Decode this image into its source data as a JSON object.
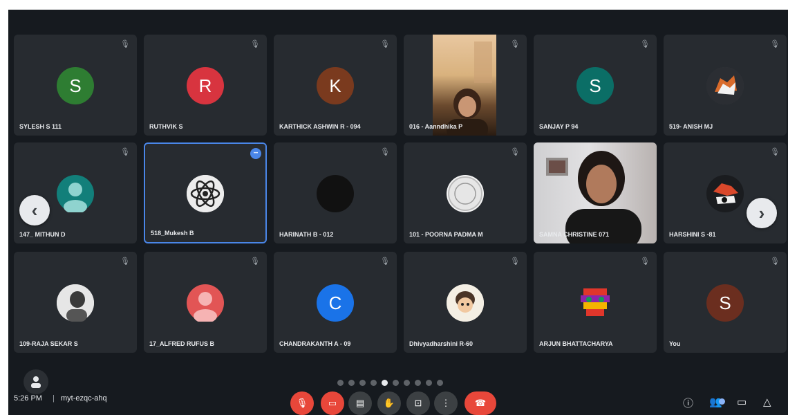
{
  "participants": [
    {
      "name": "SYLESH S 111",
      "initial": "S",
      "color": "#2e7d32"
    },
    {
      "name": "RUTHVIK S",
      "initial": "R",
      "color": "#d8343f"
    },
    {
      "name": "KARTHICK ASHWIN R - 094",
      "initial": "K",
      "color": "#7a3a1e"
    },
    {
      "name": "016 - Aanndhika P",
      "initial": "",
      "color": ""
    },
    {
      "name": "SANJAY P 94",
      "initial": "S",
      "color": "#0b6e66"
    },
    {
      "name": "519- ANISH MJ",
      "initial": "",
      "color": ""
    },
    {
      "name": "147_ MITHUN D",
      "initial": "",
      "color": "#127f7a"
    },
    {
      "name": "518_Mukesh B",
      "initial": "",
      "color": ""
    },
    {
      "name": "HARINATH B - 012",
      "initial": "",
      "color": "#111111"
    },
    {
      "name": "101 - POORNA PADMA M",
      "initial": "",
      "color": ""
    },
    {
      "name": "SAMNA CHRISTINE 071",
      "initial": "",
      "color": ""
    },
    {
      "name": "HARSHINI S -81",
      "initial": "",
      "color": ""
    },
    {
      "name": "109-RAJA SEKAR S",
      "initial": "",
      "color": ""
    },
    {
      "name": "17_ALFRED RUFUS B",
      "initial": "",
      "color": "#e25555"
    },
    {
      "name": "CHANDRAKANTH A - 09",
      "initial": "C",
      "color": "#1a73e8"
    },
    {
      "name": "Dhivyadharshini R-60",
      "initial": "",
      "color": ""
    },
    {
      "name": "ARJUN BHATTACHARYA",
      "initial": "",
      "color": ""
    },
    {
      "name": "You",
      "initial": "S",
      "color": "#6b2e1f"
    }
  ],
  "footer": {
    "time": "5:26 PM",
    "separator": "|",
    "meeting_code": "myt-ezqc-ahq"
  },
  "pagination": {
    "total": 10,
    "current": 4
  },
  "icons": {
    "mic_muted": "mic-off-icon",
    "nav_prev": "chevron-left-icon",
    "nav_next": "chevron-right-icon"
  }
}
